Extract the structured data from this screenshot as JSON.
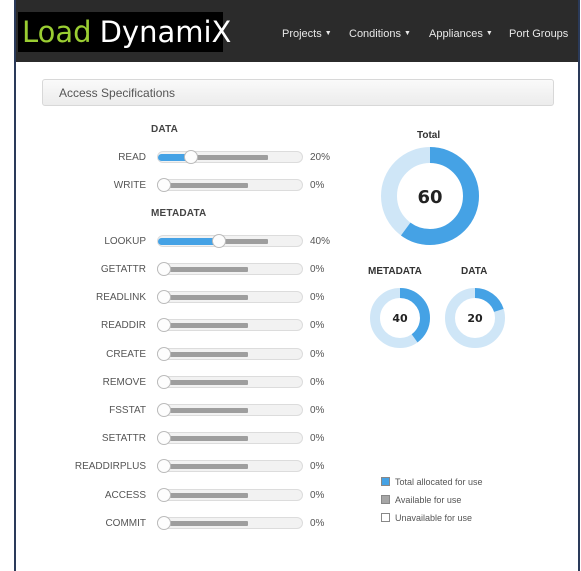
{
  "header": {
    "logo_word1": "Load",
    "logo_word2": "DynamiX",
    "nav": [
      {
        "label": "Projects",
        "has_dropdown": true
      },
      {
        "label": "Conditions",
        "has_dropdown": true
      },
      {
        "label": "Appliances",
        "has_dropdown": true
      },
      {
        "label": "Port Groups",
        "has_dropdown": false
      }
    ]
  },
  "panel": {
    "title": "Access Specifications"
  },
  "sections": {
    "data_title": "DATA",
    "metadata_title": "METADATA"
  },
  "rows": [
    {
      "label": "READ",
      "value": 20,
      "display": "20%"
    },
    {
      "label": "WRITE",
      "value": 0,
      "display": "0%"
    },
    {
      "label": "LOOKUP",
      "value": 40,
      "display": "40%"
    },
    {
      "label": "GETATTR",
      "value": 0,
      "display": "0%"
    },
    {
      "label": "READLINK",
      "value": 0,
      "display": "0%"
    },
    {
      "label": "READDIR",
      "value": 0,
      "display": "0%"
    },
    {
      "label": "CREATE",
      "value": 0,
      "display": "0%"
    },
    {
      "label": "REMOVE",
      "value": 0,
      "display": "0%"
    },
    {
      "label": "FSSTAT",
      "value": 0,
      "display": "0%"
    },
    {
      "label": "SETATTR",
      "value": 0,
      "display": "0%"
    },
    {
      "label": "READDIRPLUS",
      "value": 0,
      "display": "0%"
    },
    {
      "label": "ACCESS",
      "value": 0,
      "display": "0%"
    },
    {
      "label": "COMMIT",
      "value": 0,
      "display": "0%"
    }
  ],
  "donuts": {
    "total": {
      "label": "Total",
      "value": "60",
      "allocated_fraction": 0.6
    },
    "metadata": {
      "label": "METADATA",
      "value": "40",
      "allocated_fraction": 0.4
    },
    "data": {
      "label": "DATA",
      "value": "20",
      "allocated_fraction": 0.2
    }
  },
  "legend": [
    {
      "label": "Total allocated for use",
      "color": "#45a2e5"
    },
    {
      "label": "Available for use",
      "color": "#a6a6a6"
    },
    {
      "label": "Unavailable for use",
      "color": "#ffffff"
    }
  ],
  "colors": {
    "accent": "#45a2e5",
    "accent_light": "#cfe6f7",
    "navbar": "#2b2b2b",
    "logo_green": "#9acd32"
  }
}
